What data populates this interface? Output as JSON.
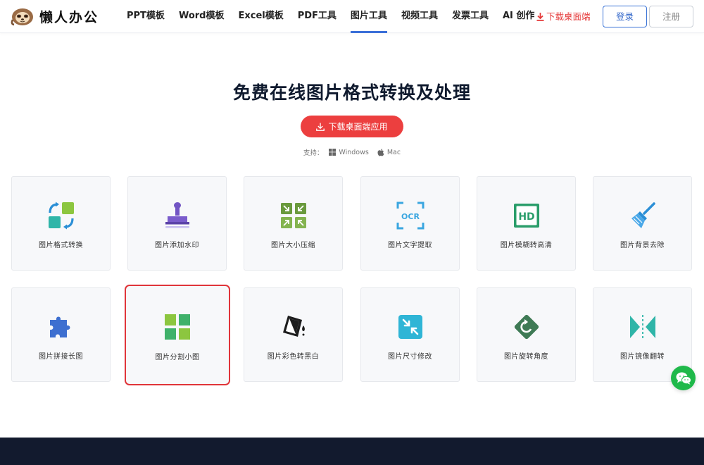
{
  "header": {
    "logo_text": "懒人办公",
    "nav": [
      {
        "label": "PPT模板",
        "active": false
      },
      {
        "label": "Word模板",
        "active": false
      },
      {
        "label": "Excel模板",
        "active": false
      },
      {
        "label": "PDF工具",
        "active": false
      },
      {
        "label": "图片工具",
        "active": true
      },
      {
        "label": "视频工具",
        "active": false
      },
      {
        "label": "发票工具",
        "active": false
      },
      {
        "label": "AI 创作",
        "active": false
      }
    ],
    "download_link": "下载桌面端",
    "login": "登录",
    "register": "注册"
  },
  "hero": {
    "title": "免费在线图片格式转换及处理",
    "download_button": "下载桌面端应用",
    "support_label": "支持：",
    "os": [
      "Windows",
      "Mac"
    ]
  },
  "tools": [
    {
      "label": "图片格式转换",
      "icon": "format-convert-icon"
    },
    {
      "label": "图片添加水印",
      "icon": "stamp-icon"
    },
    {
      "label": "图片大小压缩",
      "icon": "compress-icon"
    },
    {
      "label": "图片文字提取",
      "icon": "ocr-icon"
    },
    {
      "label": "图片模糊转高清",
      "icon": "hd-icon"
    },
    {
      "label": "图片背景去除",
      "icon": "broom-icon"
    },
    {
      "label": "图片拼接长图",
      "icon": "puzzle-icon"
    },
    {
      "label": "图片分割小图",
      "icon": "grid-split-icon",
      "selected": true
    },
    {
      "label": "图片彩色转黑白",
      "icon": "paint-bucket-icon"
    },
    {
      "label": "图片尺寸修改",
      "icon": "resize-icon"
    },
    {
      "label": "图片旋转角度",
      "icon": "rotate-icon"
    },
    {
      "label": "图片镜像翻转",
      "icon": "mirror-icon"
    }
  ],
  "colors": {
    "accent_blue": "#3b6fd8",
    "download_red": "#ec3f3f",
    "selected_border": "#e0353a",
    "chat_green": "#1fb94a",
    "footer_bg": "#121a2e"
  }
}
